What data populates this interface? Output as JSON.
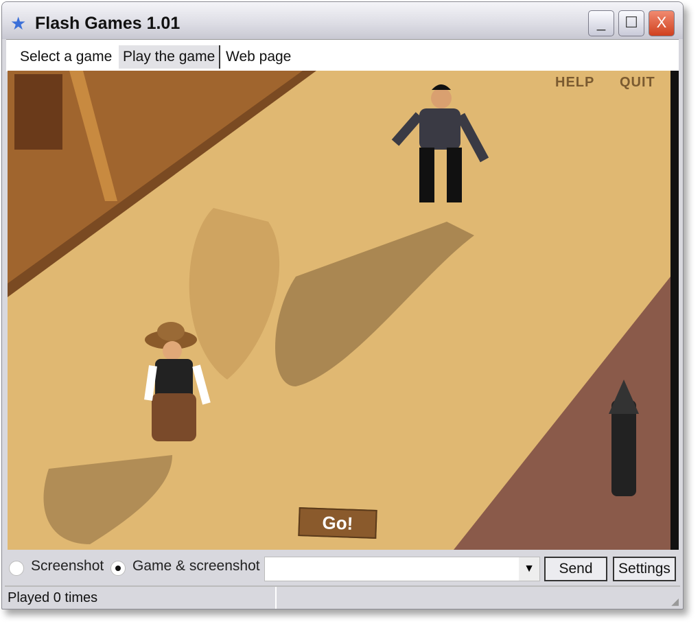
{
  "window": {
    "title": "Flash Games 1.01",
    "minimize": "_",
    "maximize": "☐",
    "close": "X"
  },
  "menu": [
    {
      "label": "Select a game"
    },
    {
      "label": "Play the game",
      "active": true
    },
    {
      "label": "Web page"
    }
  ],
  "game": {
    "help": "HELP",
    "quit": "QUIT",
    "go": "Go!"
  },
  "bottom": {
    "radio_screenshot": "Screenshot",
    "radio_game": "Game & screenshot",
    "selected": "Game & screenshot",
    "combo_value": "",
    "combo_arrow": "▼",
    "send": "Send",
    "settings": "Settings"
  },
  "status": {
    "text": "Played 0 times"
  },
  "colors": {
    "sand": "#e0b872",
    "accent_close": "#d0401e"
  }
}
